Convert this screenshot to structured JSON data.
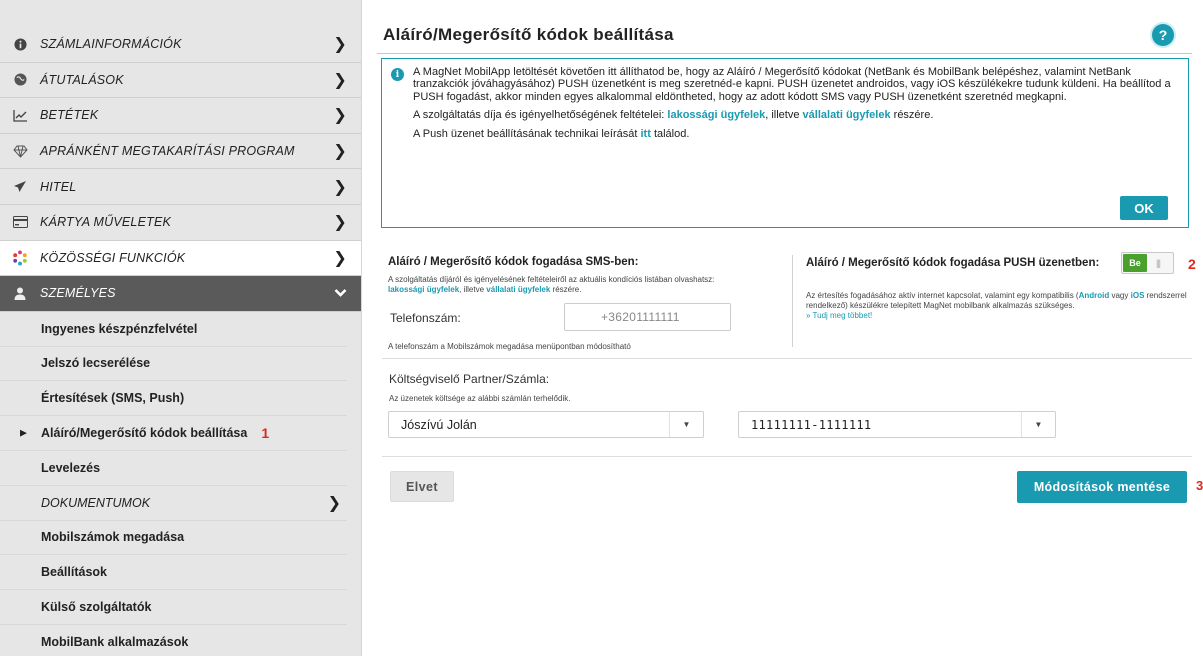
{
  "sidebar": {
    "nav": [
      {
        "label": "SZÁMLAINFORMÁCIÓK",
        "icon": "info-circle-icon"
      },
      {
        "label": "ÁTUTALÁSOK",
        "icon": "globe-icon"
      },
      {
        "label": "BETÉTEK",
        "icon": "chart-line-icon"
      },
      {
        "label": "APRÁNKÉNT MEGTAKARÍTÁSI PROGRAM",
        "icon": "diamond-icon"
      },
      {
        "label": "HITEL",
        "icon": "plane-icon"
      },
      {
        "label": "KÁRTYA MŰVELETEK",
        "icon": "card-icon"
      },
      {
        "label": "KÖZÖSSÉGI FUNKCIÓK",
        "icon": "community-logo-icon"
      },
      {
        "label": "SZEMÉLYES",
        "icon": "user-icon"
      }
    ],
    "sub": [
      {
        "label": "Ingyenes készpénzfelvétel"
      },
      {
        "label": "Jelszó lecserélése"
      },
      {
        "label": "Értesítések (SMS, Push)"
      },
      {
        "label": "Aláíró/Megerősítő kódok beállítása",
        "marker": "1"
      },
      {
        "label": "Levelezés"
      },
      {
        "label": "DOKUMENTUMOK"
      },
      {
        "label": "Mobilszámok megadása"
      },
      {
        "label": "Beállítások"
      },
      {
        "label": "Külső szolgáltatók"
      },
      {
        "label": "MobilBank alkalmazások"
      }
    ]
  },
  "main": {
    "title": "Aláíró/Megerősítő kódok beállítása",
    "help": "?",
    "info": {
      "p1": "A MagNet MobilApp letöltését követően itt állíthatod be, hogy az Aláíró / Megerősítő kódokat (NetBank és MobilBank belépéshez, valamint NetBank tranzakciók jóváhagyásához) PUSH üzenetként is meg szeretnéd-e kapni. PUSH üzenetet androidos, vagy iOS készülékekre tudunk küldeni. Ha beállítod a PUSH fogadást, akkor minden egyes alkalommal eldöntheted, hogy az adott kódott SMS vagy PUSH üzenetként szeretnéd megkapni.",
      "p2_pre": "A szolgáltatás díja és igényelhetőségének feltételei:",
      "p2_link1": "lakossági ügyfelek",
      "p2_mid": ", illetve",
      "p2_link2": "vállalati ügyfelek",
      "p2_post": "részére.",
      "p3_pre": "A Push üzenet beállításának technikai leírását",
      "p3_link": "itt",
      "p3_post": "találod.",
      "ok": "OK"
    },
    "sms": {
      "heading": "Aláíró / Megerősítő kódok fogadása SMS-ben:",
      "note_pre": "A szolgáltatás díjáról és igényelésének feltételeiről az aktuális kondíciós listában olvashatsz:",
      "note_link1": "lakossági ügyfelek",
      "note_mid": ", illetve",
      "note_link2": "vállalati ügyfelek",
      "note_post": "részére.",
      "phone_label": "Telefonszám:",
      "phone_value": "+36201111111",
      "phone_note": "A telefonszám a Mobilszámok megadása menüpontban módosítható"
    },
    "push": {
      "heading": "Aláíró / Megerősítő kódok fogadása PUSH üzenetben:",
      "toggle_on": "Be",
      "marker": "2",
      "note_pre": "Az értesítés fogadásához aktív internet kapcsolat, valamint egy kompatibilis (",
      "note_android": "Android",
      "note_mid": "vagy",
      "note_ios": "iOS",
      "note_post": "rendszerrel rendelkező) készülékre telepített MagNet mobilbank alkalmazás szükséges.",
      "more": "» Tudj meg többet!"
    },
    "cost": {
      "label": "Költségviselő Partner/Számla:",
      "note": "Az üzenetek költsége az alábbi számlán terhelődik.",
      "partner": "Jószívú Jolán",
      "account": "11111111-1111111"
    },
    "buttons": {
      "cancel": "Elvet",
      "save": "Módosítások mentése",
      "marker": "3"
    }
  },
  "colors": {
    "accent": "#1a9ab0",
    "toggle_on": "#4aa02c",
    "marker": "#e0281e"
  }
}
